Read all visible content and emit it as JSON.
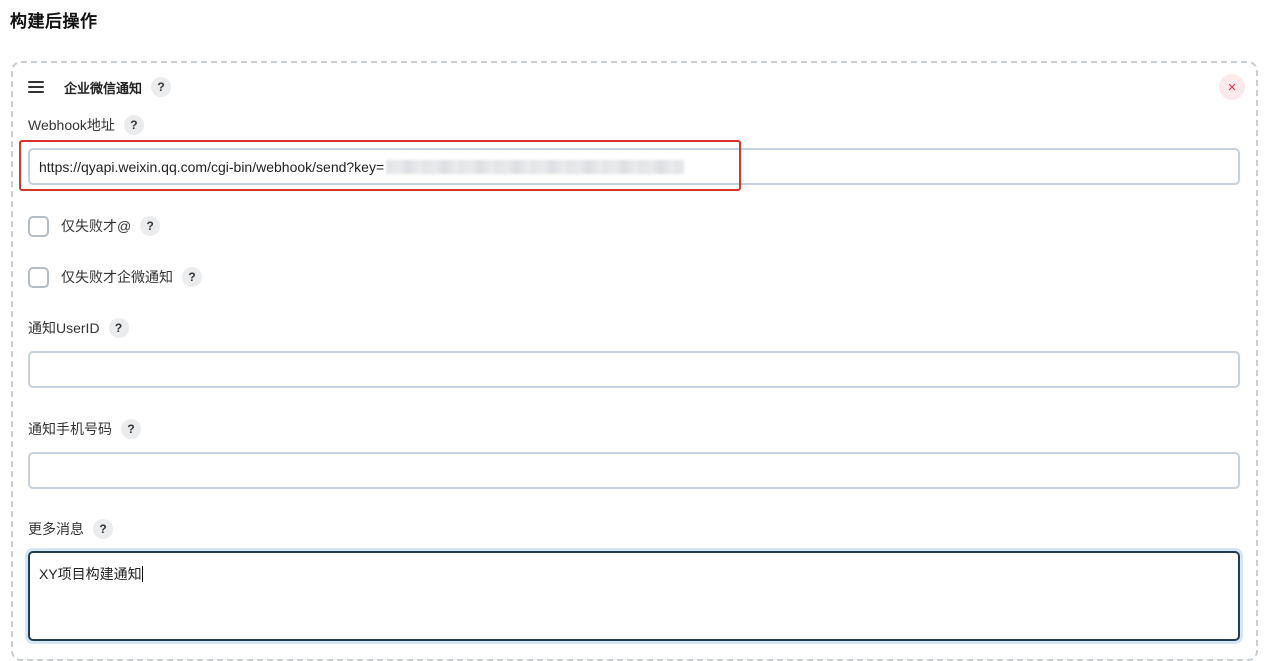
{
  "section": {
    "title": "构建后操作"
  },
  "panel": {
    "title": "企业微信通知",
    "help": "?",
    "close": "×"
  },
  "webhook": {
    "label": "Webhook地址",
    "help": "?",
    "value": "https://qyapi.weixin.qq.com/cgi-bin/webhook/send?key="
  },
  "fail_only_at": {
    "label": "仅失败才@",
    "help": "?",
    "checked": false
  },
  "fail_only_notify": {
    "label": "仅失败才企微通知",
    "help": "?",
    "checked": false
  },
  "user_id": {
    "label": "通知UserID",
    "help": "?",
    "value": ""
  },
  "mobile": {
    "label": "通知手机号码",
    "help": "?",
    "value": ""
  },
  "more_info": {
    "label": "更多消息",
    "help": "?",
    "value": "XY项目构建通知"
  },
  "colors": {
    "highlight": "#d9342b",
    "close_bg": "#fbe9ec",
    "close_fg": "#d2344a",
    "focus_border": "#1e3f52"
  }
}
